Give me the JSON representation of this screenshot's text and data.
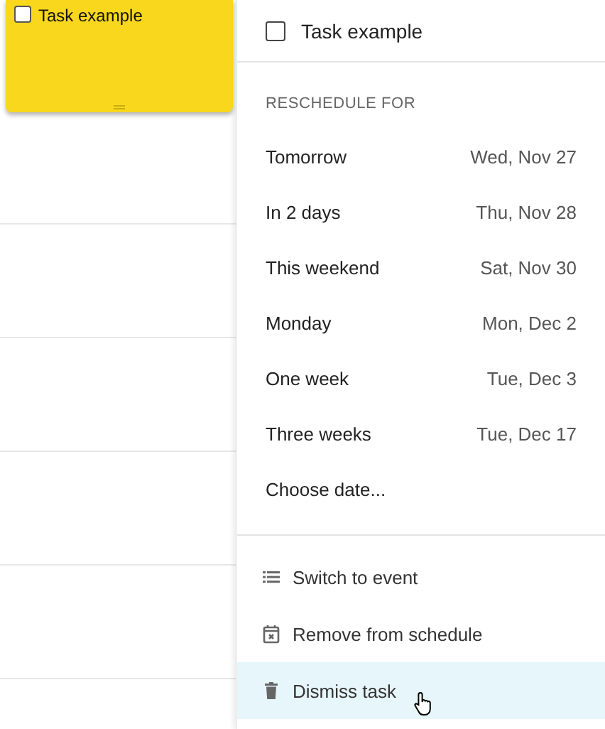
{
  "task_card": {
    "title": "Task example",
    "checked": false
  },
  "menu": {
    "task": {
      "title": "Task example",
      "checked": false
    },
    "section_title": "RESCHEDULE FOR",
    "options": [
      {
        "label": "Tomorrow",
        "date": "Wed, Nov 27"
      },
      {
        "label": "In 2 days",
        "date": "Thu, Nov 28"
      },
      {
        "label": "This weekend",
        "date": "Sat, Nov 30"
      },
      {
        "label": "Monday",
        "date": "Mon, Dec 2"
      },
      {
        "label": "One week",
        "date": "Tue, Dec 3"
      },
      {
        "label": "Three weeks",
        "date": "Tue, Dec 17"
      },
      {
        "label": "Choose date..."
      }
    ],
    "actions": [
      {
        "kind": "list",
        "label": "Switch to event",
        "hovered": false
      },
      {
        "kind": "unschedule",
        "label": "Remove from schedule",
        "hovered": false
      },
      {
        "kind": "trash",
        "label": "Dismiss task",
        "hovered": true
      }
    ]
  }
}
